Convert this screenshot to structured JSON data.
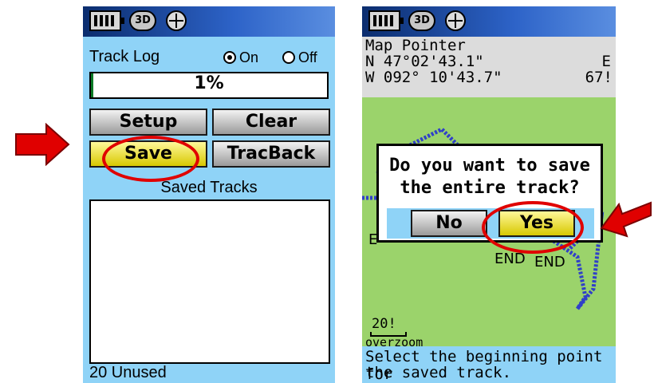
{
  "colors": {
    "screen_bg": "#8fd3f7",
    "map_bg": "#9bd36b",
    "highlight": "#e8e000",
    "annotation": "#e00000",
    "track": "#3040c8"
  },
  "left_screen": {
    "status_icons": [
      "battery-icon",
      "gps-3d-icon",
      "satellite-icon"
    ],
    "status_3d_text": "3D",
    "track_log_label": "Track Log",
    "radio_on": "On",
    "radio_off": "Off",
    "selected": "On",
    "progress_text": "1%",
    "progress_fraction": 0.01,
    "buttons": {
      "setup": "Setup",
      "clear": "Clear",
      "save": "Save",
      "tracback": "TracBack"
    },
    "saved_tracks_title": "Saved Tracks",
    "footer": "20 Unused"
  },
  "right_screen": {
    "header_title": "Map Pointer",
    "lat": "N  47°02'43.1\"",
    "lon": "W 092° 10'43.7\"",
    "right_col_1": "E",
    "right_col_2": "67!",
    "dialog_line1": "Do you want to save",
    "dialog_line2": "the entire track?",
    "no_label": "No",
    "yes_label": "Yes",
    "map_end_1": "END",
    "map_end_2": "END",
    "map_e": "E",
    "scale": "20!",
    "overzoom": "overzoom",
    "footer_line1": "Select the beginning point for",
    "footer_line2": "the saved track."
  }
}
